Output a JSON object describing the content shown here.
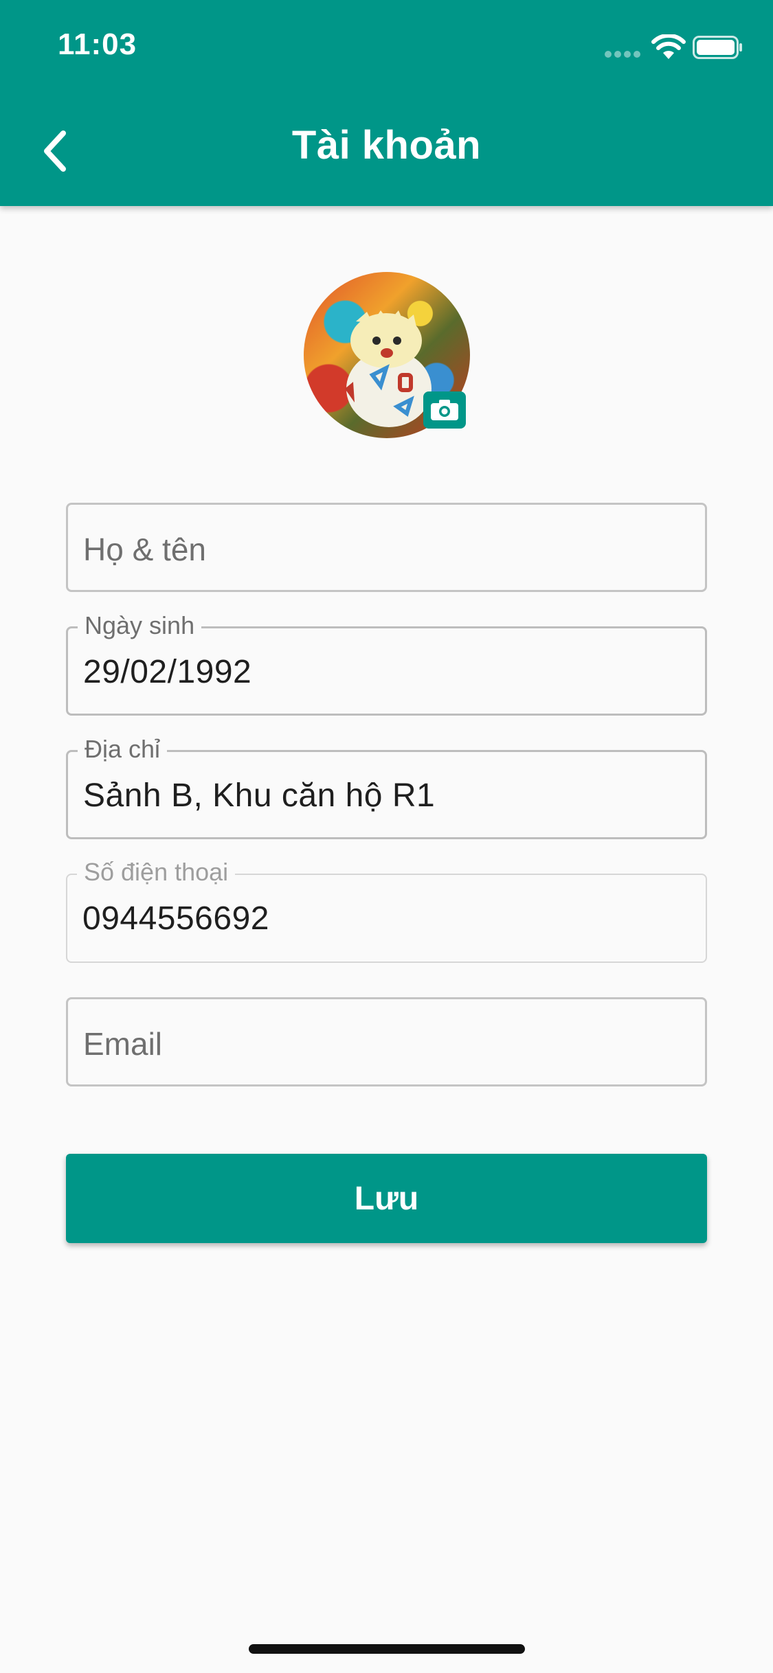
{
  "status_bar": {
    "time": "11:03",
    "icons": [
      "cellular-signal-icon",
      "wifi-icon",
      "battery-icon"
    ]
  },
  "app_bar": {
    "title": "Tài khoản",
    "back_icon": "chevron-left-icon",
    "background_color": "#009688"
  },
  "profile": {
    "avatar_icon": "camera-icon"
  },
  "form": {
    "full_name": {
      "placeholder": "Họ & tên",
      "value": ""
    },
    "birthday": {
      "label": "Ngày sinh",
      "value": "29/02/1992"
    },
    "address": {
      "label": "Địa chỉ",
      "value": "Sảnh B, Khu căn hộ R1"
    },
    "phone": {
      "label": "Số điện thoại",
      "value": "0944556692",
      "disabled": true
    },
    "email": {
      "placeholder": "Email",
      "value": ""
    },
    "save_label": "Lưu"
  },
  "colors": {
    "accent": "#009688",
    "background": "#fafafa"
  }
}
